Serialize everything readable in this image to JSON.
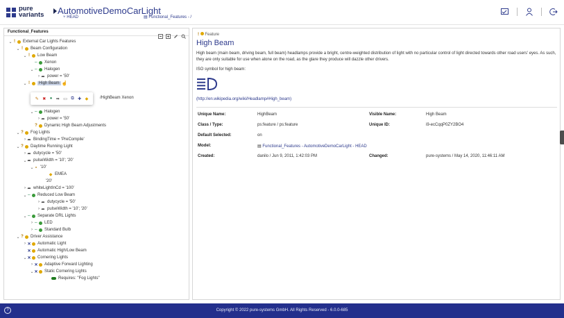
{
  "header": {
    "logo_text_1": "pure",
    "logo_text_2": "variants",
    "title": "AutomotiveDemoCarLight",
    "branch": "HEAD",
    "breadcrumb": "Functional_Features - /"
  },
  "left_panel": {
    "title": "Functional_Features",
    "tree": [
      {
        "label": "External Car Lights Features"
      },
      {
        "label": "Beam Configuration"
      },
      {
        "label": "Low Beam"
      },
      {
        "label": "Xenon"
      },
      {
        "label": "Halogen"
      },
      {
        "label": "power = '50'"
      },
      {
        "label": "High Beam"
      },
      {
        "label": "/HighBeam Xenon"
      },
      {
        "label": "Halogen"
      },
      {
        "label": "power = '50'"
      },
      {
        "label": "Dynamic High Beam Adjustments"
      },
      {
        "label": "Fog Lights"
      },
      {
        "label": "BindingTime = 'PreCompile'"
      },
      {
        "label": "Daytime Running Light"
      },
      {
        "label": "dutycycle = '50'"
      },
      {
        "label": "pulseWidth = '10'; '20'"
      },
      {
        "label": "'10'"
      },
      {
        "label": "EMEA"
      },
      {
        "label": "'20'"
      },
      {
        "label": "whiteLightInCd = '100'"
      },
      {
        "label": "Reduced Low Beam"
      },
      {
        "label": "dutycycle = '50'"
      },
      {
        "label": "pulseWidth = '10'; '20'"
      },
      {
        "label": "Separate DRL Lights"
      },
      {
        "label": "LED"
      },
      {
        "label": "Standard Bulb"
      },
      {
        "label": "Driver Assistance"
      },
      {
        "label": "Automatic Light"
      },
      {
        "label": "Automatic High/Low Beam"
      },
      {
        "label": "Cornering Lights"
      },
      {
        "label": "Adaptive Forward Lighting"
      },
      {
        "label": "Static Cornering Lights"
      },
      {
        "label": "Requires: \"Fog Lights\""
      }
    ]
  },
  "details": {
    "type_label": "Feature",
    "title": "High Beam",
    "description": "High beam (main beam, driving beam, full beam) headlamps provide a bright, centre-weighted distribution of light with no particular control of light directed towards other road users' eyes. As such, they are only suitable for use when alone on the road, as the glare they produce will dazzle other drivers.",
    "iso_text": "ISO symbol for high beam:",
    "link": "(http://en.wikipedia.org/wiki/Headlamp#High_beam)",
    "props": {
      "unique_name_label": "Unique Name:",
      "unique_name": "HighBeam",
      "visible_name_label": "Visible Name:",
      "visible_name": "High Beam",
      "class_type_label": "Class / Type:",
      "class_type": "ps:feature / ps:feature",
      "unique_id_label": "Unique ID:",
      "unique_id": "i9-ecCqqP0ZY2BO4",
      "default_selected_label": "Default Selected:",
      "default_selected": "on",
      "model_label": "Model:",
      "model": "Functional_Features - AutomotiveDemoCarLight - HEAD",
      "created_label": "Created:",
      "created": "danilo / Jun 9, 2011, 1:42:03 PM",
      "changed_label": "Changed:",
      "changed": "pure-systems / May 14, 2020, 11:46:11 AM"
    }
  },
  "footer": {
    "help": "?",
    "copyright": "Copyright © 2022 pure-systems GmbH. All Rights Reserved - 6.0.0-685"
  },
  "colors": {
    "brand": "#2d3a8c",
    "footer_bg": "#232f8c",
    "selection": "#c8d2e6"
  }
}
